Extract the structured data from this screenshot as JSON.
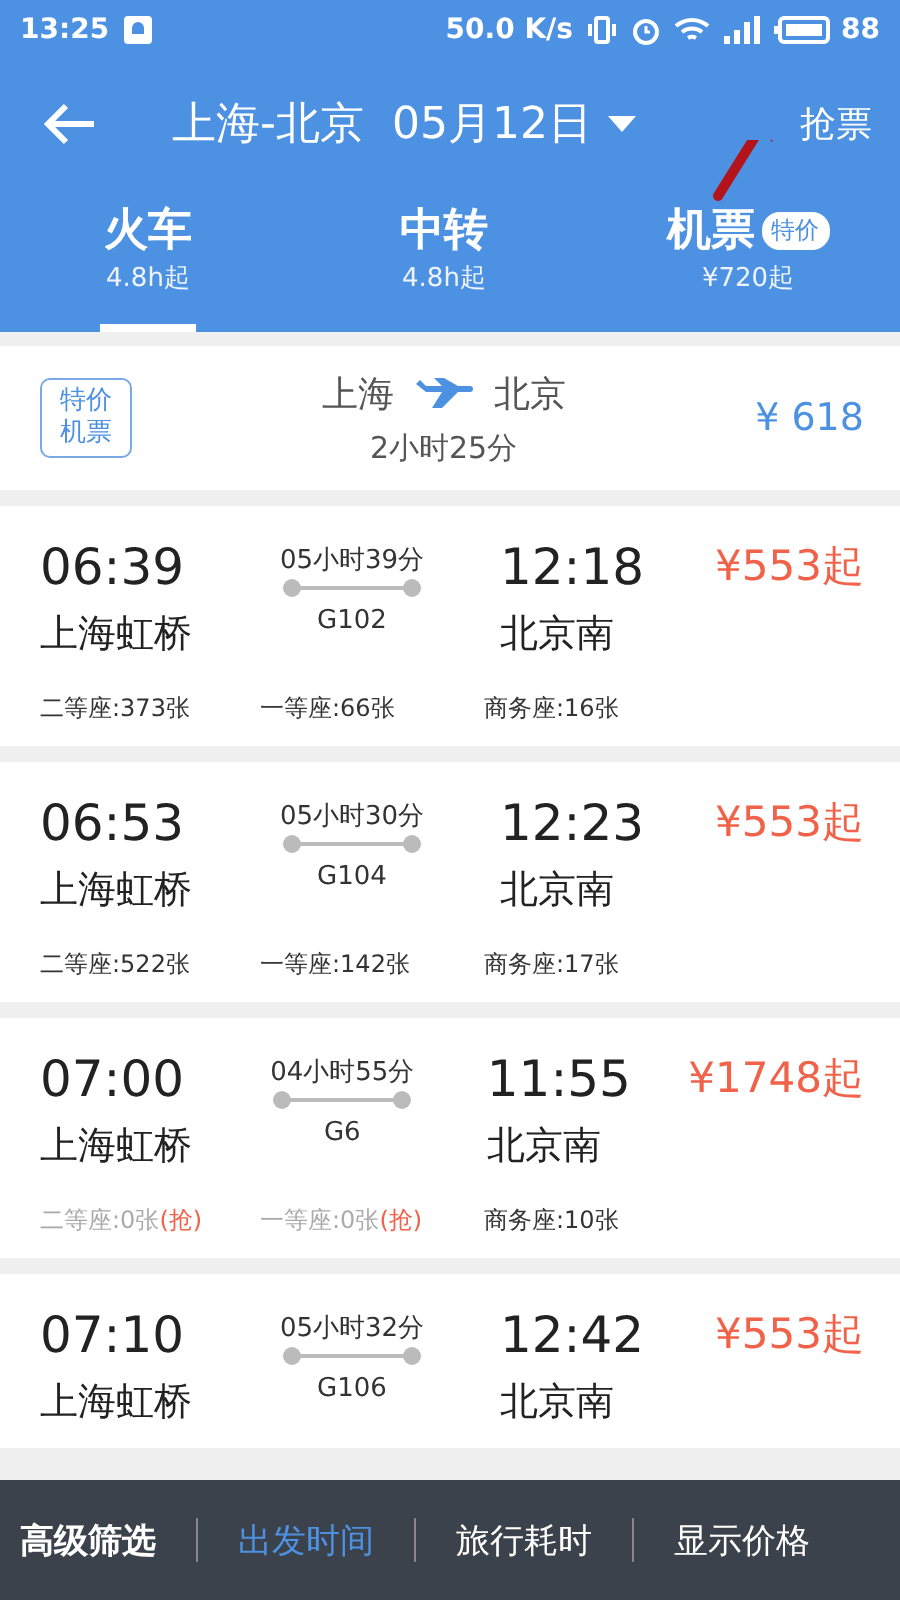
{
  "status_bar": {
    "time": "13:25",
    "speed": "50.0 K/s",
    "battery": "88"
  },
  "header": {
    "route": "上海-北京",
    "date": "05月12日",
    "action": "抢票"
  },
  "tabs": [
    {
      "label": "火车",
      "sub": "4.8h起",
      "selected": true
    },
    {
      "label": "中转",
      "sub": "4.8h起",
      "selected": false
    },
    {
      "label": "机票",
      "sub": "¥720起",
      "badge": "特价",
      "selected": false
    }
  ],
  "flight_card": {
    "badge": "特价机票",
    "from": "上海",
    "to": "北京",
    "duration": "2小时25分",
    "price": "¥ 618"
  },
  "trains": [
    {
      "depart": "06:39",
      "from": "上海虹桥",
      "duration": "05小时39分",
      "number": "G102",
      "arrive": "12:18",
      "to": "北京南",
      "price": "¥553起",
      "seats": [
        {
          "text": "二等座:373张",
          "sold_out": false
        },
        {
          "text": "一等座:66张",
          "sold_out": false
        },
        {
          "text": "商务座:16张",
          "sold_out": false
        }
      ]
    },
    {
      "depart": "06:53",
      "from": "上海虹桥",
      "duration": "05小时30分",
      "number": "G104",
      "arrive": "12:23",
      "to": "北京南",
      "price": "¥553起",
      "seats": [
        {
          "text": "二等座:522张",
          "sold_out": false
        },
        {
          "text": "一等座:142张",
          "sold_out": false
        },
        {
          "text": "商务座:17张",
          "sold_out": false
        }
      ]
    },
    {
      "depart": "07:00",
      "from": "上海虹桥",
      "duration": "04小时55分",
      "number": "G6",
      "arrive": "11:55",
      "to": "北京南",
      "price": "¥1748起",
      "seats": [
        {
          "text": "二等座:0张",
          "sold_out": true,
          "grab": "(抢)"
        },
        {
          "text": "一等座:0张",
          "sold_out": true,
          "grab": "(抢)"
        },
        {
          "text": "商务座:10张",
          "sold_out": false
        }
      ]
    },
    {
      "depart": "07:10",
      "from": "上海虹桥",
      "duration": "05小时32分",
      "number": "G106",
      "arrive": "12:42",
      "to": "北京南",
      "price": "¥553起"
    }
  ],
  "bottom_bar": {
    "filter": "高级筛选",
    "sorts": [
      {
        "label": "出发时间",
        "selected": true
      },
      {
        "label": "旅行耗时",
        "selected": false
      },
      {
        "label": "显示价格",
        "selected": false
      }
    ]
  }
}
